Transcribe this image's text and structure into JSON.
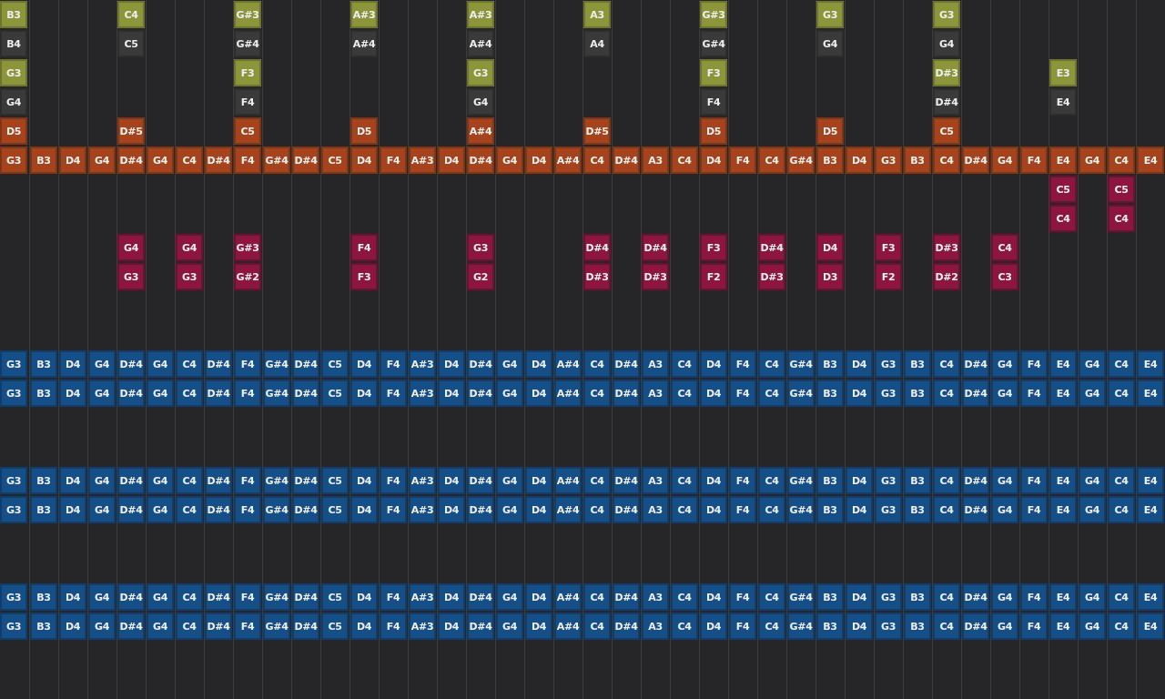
{
  "rows": [
    {
      "kind": "lane",
      "color": "#8c953a",
      "notes": [
        {
          "kind": "note",
          "label": "B3"
        },
        {
          "kind": "rest"
        },
        {
          "kind": "rest"
        },
        {
          "kind": "rest"
        },
        {
          "kind": "note",
          "label": "C4"
        },
        {
          "kind": "rest"
        },
        {
          "kind": "rest"
        },
        {
          "kind": "rest"
        },
        {
          "kind": "note",
          "label": "G#3"
        },
        {
          "kind": "rest"
        },
        {
          "kind": "rest"
        },
        {
          "kind": "rest"
        },
        {
          "kind": "note",
          "label": "A#3"
        },
        {
          "kind": "rest"
        },
        {
          "kind": "rest"
        },
        {
          "kind": "rest"
        },
        {
          "kind": "note",
          "label": "A#3"
        },
        {
          "kind": "rest"
        },
        {
          "kind": "rest"
        },
        {
          "kind": "rest"
        },
        {
          "kind": "note",
          "label": "A3"
        },
        {
          "kind": "rest"
        },
        {
          "kind": "rest"
        },
        {
          "kind": "rest"
        },
        {
          "kind": "note",
          "label": "G#3"
        },
        {
          "kind": "rest"
        },
        {
          "kind": "rest"
        },
        {
          "kind": "rest"
        },
        {
          "kind": "note",
          "label": "G3"
        },
        {
          "kind": "rest"
        },
        {
          "kind": "rest"
        },
        {
          "kind": "rest"
        },
        {
          "kind": "note",
          "label": "G3"
        },
        {
          "kind": "rest"
        },
        {
          "kind": "rest"
        },
        {
          "kind": "rest"
        },
        {
          "kind": "rest"
        },
        {
          "kind": "rest"
        },
        {
          "kind": "rest"
        },
        {
          "kind": "rest"
        }
      ]
    },
    {
      "kind": "lane",
      "color": "#3a3a3b",
      "notes": [
        {
          "kind": "note",
          "label": "B4"
        },
        {
          "kind": "rest"
        },
        {
          "kind": "rest"
        },
        {
          "kind": "rest"
        },
        {
          "kind": "note",
          "label": "C5"
        },
        {
          "kind": "rest"
        },
        {
          "kind": "rest"
        },
        {
          "kind": "rest"
        },
        {
          "kind": "note",
          "label": "G#4"
        },
        {
          "kind": "rest"
        },
        {
          "kind": "rest"
        },
        {
          "kind": "rest"
        },
        {
          "kind": "note",
          "label": "A#4"
        },
        {
          "kind": "rest"
        },
        {
          "kind": "rest"
        },
        {
          "kind": "rest"
        },
        {
          "kind": "note",
          "label": "A#4"
        },
        {
          "kind": "rest"
        },
        {
          "kind": "rest"
        },
        {
          "kind": "rest"
        },
        {
          "kind": "note",
          "label": "A4"
        },
        {
          "kind": "rest"
        },
        {
          "kind": "rest"
        },
        {
          "kind": "rest"
        },
        {
          "kind": "note",
          "label": "G#4"
        },
        {
          "kind": "rest"
        },
        {
          "kind": "rest"
        },
        {
          "kind": "rest"
        },
        {
          "kind": "note",
          "label": "G4"
        },
        {
          "kind": "rest"
        },
        {
          "kind": "rest"
        },
        {
          "kind": "rest"
        },
        {
          "kind": "note",
          "label": "G4"
        },
        {
          "kind": "rest"
        },
        {
          "kind": "rest"
        },
        {
          "kind": "rest"
        },
        {
          "kind": "rest"
        },
        {
          "kind": "rest"
        },
        {
          "kind": "rest"
        },
        {
          "kind": "rest"
        }
      ]
    },
    {
      "kind": "lane",
      "color": "#8c953a",
      "notes": [
        {
          "kind": "note",
          "label": "G3"
        },
        {
          "kind": "rest"
        },
        {
          "kind": "rest"
        },
        {
          "kind": "rest"
        },
        {
          "kind": "rest"
        },
        {
          "kind": "rest"
        },
        {
          "kind": "rest"
        },
        {
          "kind": "rest"
        },
        {
          "kind": "note",
          "label": "F3"
        },
        {
          "kind": "rest"
        },
        {
          "kind": "rest"
        },
        {
          "kind": "rest"
        },
        {
          "kind": "rest"
        },
        {
          "kind": "rest"
        },
        {
          "kind": "rest"
        },
        {
          "kind": "rest"
        },
        {
          "kind": "note",
          "label": "G3"
        },
        {
          "kind": "rest"
        },
        {
          "kind": "rest"
        },
        {
          "kind": "rest"
        },
        {
          "kind": "rest"
        },
        {
          "kind": "rest"
        },
        {
          "kind": "rest"
        },
        {
          "kind": "rest"
        },
        {
          "kind": "note",
          "label": "F3"
        },
        {
          "kind": "rest"
        },
        {
          "kind": "rest"
        },
        {
          "kind": "rest"
        },
        {
          "kind": "rest"
        },
        {
          "kind": "rest"
        },
        {
          "kind": "rest"
        },
        {
          "kind": "rest"
        },
        {
          "kind": "note",
          "label": "D#3"
        },
        {
          "kind": "rest"
        },
        {
          "kind": "rest"
        },
        {
          "kind": "rest"
        },
        {
          "kind": "note",
          "label": "E3"
        },
        {
          "kind": "rest"
        },
        {
          "kind": "rest"
        },
        {
          "kind": "rest"
        }
      ]
    },
    {
      "kind": "lane",
      "color": "#3a3a3b",
      "notes": [
        {
          "kind": "note",
          "label": "G4"
        },
        {
          "kind": "rest"
        },
        {
          "kind": "rest"
        },
        {
          "kind": "rest"
        },
        {
          "kind": "rest"
        },
        {
          "kind": "rest"
        },
        {
          "kind": "rest"
        },
        {
          "kind": "rest"
        },
        {
          "kind": "note",
          "label": "F4"
        },
        {
          "kind": "rest"
        },
        {
          "kind": "rest"
        },
        {
          "kind": "rest"
        },
        {
          "kind": "rest"
        },
        {
          "kind": "rest"
        },
        {
          "kind": "rest"
        },
        {
          "kind": "rest"
        },
        {
          "kind": "note",
          "label": "G4"
        },
        {
          "kind": "rest"
        },
        {
          "kind": "rest"
        },
        {
          "kind": "rest"
        },
        {
          "kind": "rest"
        },
        {
          "kind": "rest"
        },
        {
          "kind": "rest"
        },
        {
          "kind": "rest"
        },
        {
          "kind": "note",
          "label": "F4"
        },
        {
          "kind": "rest"
        },
        {
          "kind": "rest"
        },
        {
          "kind": "rest"
        },
        {
          "kind": "rest"
        },
        {
          "kind": "rest"
        },
        {
          "kind": "rest"
        },
        {
          "kind": "rest"
        },
        {
          "kind": "note",
          "label": "D#4"
        },
        {
          "kind": "rest"
        },
        {
          "kind": "rest"
        },
        {
          "kind": "rest"
        },
        {
          "kind": "note",
          "label": "E4"
        },
        {
          "kind": "rest"
        },
        {
          "kind": "rest"
        },
        {
          "kind": "rest"
        }
      ]
    },
    {
      "kind": "lane",
      "color": "#a5441c",
      "notes": [
        {
          "kind": "note",
          "label": "D5"
        },
        {
          "kind": "rest"
        },
        {
          "kind": "rest"
        },
        {
          "kind": "rest"
        },
        {
          "kind": "note",
          "label": "D#5"
        },
        {
          "kind": "rest"
        },
        {
          "kind": "rest"
        },
        {
          "kind": "rest"
        },
        {
          "kind": "note",
          "label": "C5"
        },
        {
          "kind": "rest"
        },
        {
          "kind": "rest"
        },
        {
          "kind": "rest"
        },
        {
          "kind": "note",
          "label": "D5"
        },
        {
          "kind": "rest"
        },
        {
          "kind": "rest"
        },
        {
          "kind": "rest"
        },
        {
          "kind": "note",
          "label": "A#4"
        },
        {
          "kind": "rest"
        },
        {
          "kind": "rest"
        },
        {
          "kind": "rest"
        },
        {
          "kind": "note",
          "label": "D#5"
        },
        {
          "kind": "rest"
        },
        {
          "kind": "rest"
        },
        {
          "kind": "rest"
        },
        {
          "kind": "note",
          "label": "D5"
        },
        {
          "kind": "rest"
        },
        {
          "kind": "rest"
        },
        {
          "kind": "rest"
        },
        {
          "kind": "note",
          "label": "D5"
        },
        {
          "kind": "rest"
        },
        {
          "kind": "rest"
        },
        {
          "kind": "rest"
        },
        {
          "kind": "note",
          "label": "C5"
        },
        {
          "kind": "rest"
        },
        {
          "kind": "rest"
        },
        {
          "kind": "rest"
        },
        {
          "kind": "rest"
        },
        {
          "kind": "rest"
        },
        {
          "kind": "rest"
        },
        {
          "kind": "rest"
        }
      ]
    },
    {
      "kind": "lane",
      "color": "#a5441c",
      "notes": [
        {
          "kind": "note",
          "label": "G3"
        },
        {
          "kind": "note",
          "label": "B3"
        },
        {
          "kind": "note",
          "label": "D4"
        },
        {
          "kind": "note",
          "label": "G4"
        },
        {
          "kind": "note",
          "label": "D#4"
        },
        {
          "kind": "note",
          "label": "G4"
        },
        {
          "kind": "note",
          "label": "C4"
        },
        {
          "kind": "note",
          "label": "D#4"
        },
        {
          "kind": "note",
          "label": "F4"
        },
        {
          "kind": "note",
          "label": "G#4"
        },
        {
          "kind": "note",
          "label": "D#4"
        },
        {
          "kind": "note",
          "label": "C5"
        },
        {
          "kind": "note",
          "label": "D4"
        },
        {
          "kind": "note",
          "label": "F4"
        },
        {
          "kind": "note",
          "label": "A#3"
        },
        {
          "kind": "note",
          "label": "D4"
        },
        {
          "kind": "note",
          "label": "D#4"
        },
        {
          "kind": "note",
          "label": "G4"
        },
        {
          "kind": "note",
          "label": "D4"
        },
        {
          "kind": "note",
          "label": "A#4"
        },
        {
          "kind": "note",
          "label": "C4"
        },
        {
          "kind": "note",
          "label": "D#4"
        },
        {
          "kind": "note",
          "label": "A3"
        },
        {
          "kind": "note",
          "label": "C4"
        },
        {
          "kind": "note",
          "label": "D4"
        },
        {
          "kind": "note",
          "label": "F4"
        },
        {
          "kind": "note",
          "label": "C4"
        },
        {
          "kind": "note",
          "label": "G#4"
        },
        {
          "kind": "note",
          "label": "B3"
        },
        {
          "kind": "note",
          "label": "D4"
        },
        {
          "kind": "note",
          "label": "G3"
        },
        {
          "kind": "note",
          "label": "B3"
        },
        {
          "kind": "note",
          "label": "C4"
        },
        {
          "kind": "note",
          "label": "D#4"
        },
        {
          "kind": "note",
          "label": "G4"
        },
        {
          "kind": "note",
          "label": "F4"
        },
        {
          "kind": "note",
          "label": "E4"
        },
        {
          "kind": "note",
          "label": "G4"
        },
        {
          "kind": "note",
          "label": "C4"
        },
        {
          "kind": "note",
          "label": "E4"
        }
      ]
    },
    {
      "kind": "lane",
      "color": "#8c1640",
      "notes": [
        {
          "kind": "rest"
        },
        {
          "kind": "rest"
        },
        {
          "kind": "rest"
        },
        {
          "kind": "rest"
        },
        {
          "kind": "rest"
        },
        {
          "kind": "rest"
        },
        {
          "kind": "rest"
        },
        {
          "kind": "rest"
        },
        {
          "kind": "rest"
        },
        {
          "kind": "rest"
        },
        {
          "kind": "rest"
        },
        {
          "kind": "rest"
        },
        {
          "kind": "rest"
        },
        {
          "kind": "rest"
        },
        {
          "kind": "rest"
        },
        {
          "kind": "rest"
        },
        {
          "kind": "rest"
        },
        {
          "kind": "rest"
        },
        {
          "kind": "rest"
        },
        {
          "kind": "rest"
        },
        {
          "kind": "rest"
        },
        {
          "kind": "rest"
        },
        {
          "kind": "rest"
        },
        {
          "kind": "rest"
        },
        {
          "kind": "rest"
        },
        {
          "kind": "rest"
        },
        {
          "kind": "rest"
        },
        {
          "kind": "rest"
        },
        {
          "kind": "rest"
        },
        {
          "kind": "rest"
        },
        {
          "kind": "rest"
        },
        {
          "kind": "rest"
        },
        {
          "kind": "rest"
        },
        {
          "kind": "rest"
        },
        {
          "kind": "rest"
        },
        {
          "kind": "rest"
        },
        {
          "kind": "note",
          "label": "C5"
        },
        {
          "kind": "rest"
        },
        {
          "kind": "note",
          "label": "C5"
        },
        {
          "kind": "rest"
        }
      ]
    },
    {
      "kind": "lane",
      "color": "#8c1640",
      "notes": [
        {
          "kind": "rest"
        },
        {
          "kind": "rest"
        },
        {
          "kind": "rest"
        },
        {
          "kind": "rest"
        },
        {
          "kind": "rest"
        },
        {
          "kind": "rest"
        },
        {
          "kind": "rest"
        },
        {
          "kind": "rest"
        },
        {
          "kind": "rest"
        },
        {
          "kind": "rest"
        },
        {
          "kind": "rest"
        },
        {
          "kind": "rest"
        },
        {
          "kind": "rest"
        },
        {
          "kind": "rest"
        },
        {
          "kind": "rest"
        },
        {
          "kind": "rest"
        },
        {
          "kind": "rest"
        },
        {
          "kind": "rest"
        },
        {
          "kind": "rest"
        },
        {
          "kind": "rest"
        },
        {
          "kind": "rest"
        },
        {
          "kind": "rest"
        },
        {
          "kind": "rest"
        },
        {
          "kind": "rest"
        },
        {
          "kind": "rest"
        },
        {
          "kind": "rest"
        },
        {
          "kind": "rest"
        },
        {
          "kind": "rest"
        },
        {
          "kind": "rest"
        },
        {
          "kind": "rest"
        },
        {
          "kind": "rest"
        },
        {
          "kind": "rest"
        },
        {
          "kind": "rest"
        },
        {
          "kind": "rest"
        },
        {
          "kind": "rest"
        },
        {
          "kind": "rest"
        },
        {
          "kind": "note",
          "label": "C4"
        },
        {
          "kind": "rest"
        },
        {
          "kind": "note",
          "label": "C4"
        },
        {
          "kind": "rest"
        }
      ]
    },
    {
      "kind": "lane",
      "color": "#8c1640",
      "notes": [
        {
          "kind": "rest"
        },
        {
          "kind": "rest"
        },
        {
          "kind": "rest"
        },
        {
          "kind": "rest"
        },
        {
          "kind": "note",
          "label": "G4"
        },
        {
          "kind": "rest"
        },
        {
          "kind": "note",
          "label": "G4"
        },
        {
          "kind": "rest"
        },
        {
          "kind": "note",
          "label": "G#3"
        },
        {
          "kind": "rest"
        },
        {
          "kind": "rest"
        },
        {
          "kind": "rest"
        },
        {
          "kind": "note",
          "label": "F4"
        },
        {
          "kind": "rest"
        },
        {
          "kind": "rest"
        },
        {
          "kind": "rest"
        },
        {
          "kind": "note",
          "label": "G3"
        },
        {
          "kind": "rest"
        },
        {
          "kind": "rest"
        },
        {
          "kind": "rest"
        },
        {
          "kind": "note",
          "label": "D#4"
        },
        {
          "kind": "rest"
        },
        {
          "kind": "note",
          "label": "D#4"
        },
        {
          "kind": "rest"
        },
        {
          "kind": "note",
          "label": "F3"
        },
        {
          "kind": "rest"
        },
        {
          "kind": "note",
          "label": "D#4"
        },
        {
          "kind": "rest"
        },
        {
          "kind": "note",
          "label": "D4"
        },
        {
          "kind": "rest"
        },
        {
          "kind": "note",
          "label": "F3"
        },
        {
          "kind": "rest"
        },
        {
          "kind": "note",
          "label": "D#3"
        },
        {
          "kind": "rest"
        },
        {
          "kind": "note",
          "label": "C4"
        },
        {
          "kind": "rest"
        },
        {
          "kind": "rest"
        },
        {
          "kind": "rest"
        },
        {
          "kind": "rest"
        },
        {
          "kind": "rest"
        }
      ]
    },
    {
      "kind": "lane",
      "color": "#8c1640",
      "notes": [
        {
          "kind": "rest"
        },
        {
          "kind": "rest"
        },
        {
          "kind": "rest"
        },
        {
          "kind": "rest"
        },
        {
          "kind": "note",
          "label": "G3"
        },
        {
          "kind": "rest"
        },
        {
          "kind": "note",
          "label": "G3"
        },
        {
          "kind": "rest"
        },
        {
          "kind": "note",
          "label": "G#2"
        },
        {
          "kind": "rest"
        },
        {
          "kind": "rest"
        },
        {
          "kind": "rest"
        },
        {
          "kind": "note",
          "label": "F3"
        },
        {
          "kind": "rest"
        },
        {
          "kind": "rest"
        },
        {
          "kind": "rest"
        },
        {
          "kind": "note",
          "label": "G2"
        },
        {
          "kind": "rest"
        },
        {
          "kind": "rest"
        },
        {
          "kind": "rest"
        },
        {
          "kind": "note",
          "label": "D#3"
        },
        {
          "kind": "rest"
        },
        {
          "kind": "note",
          "label": "D#3"
        },
        {
          "kind": "rest"
        },
        {
          "kind": "note",
          "label": "F2"
        },
        {
          "kind": "rest"
        },
        {
          "kind": "note",
          "label": "D#3"
        },
        {
          "kind": "rest"
        },
        {
          "kind": "note",
          "label": "D3"
        },
        {
          "kind": "rest"
        },
        {
          "kind": "note",
          "label": "F2"
        },
        {
          "kind": "rest"
        },
        {
          "kind": "note",
          "label": "D#2"
        },
        {
          "kind": "rest"
        },
        {
          "kind": "note",
          "label": "C3"
        },
        {
          "kind": "rest"
        },
        {
          "kind": "rest"
        },
        {
          "kind": "rest"
        },
        {
          "kind": "rest"
        },
        {
          "kind": "rest"
        }
      ]
    },
    {
      "kind": "spacer"
    },
    {
      "kind": "spacer"
    },
    {
      "kind": "lane",
      "color": "#154f88",
      "notes": [
        {
          "kind": "note",
          "label": "G3"
        },
        {
          "kind": "note",
          "label": "B3"
        },
        {
          "kind": "note",
          "label": "D4"
        },
        {
          "kind": "note",
          "label": "G4"
        },
        {
          "kind": "note",
          "label": "D#4"
        },
        {
          "kind": "note",
          "label": "G4"
        },
        {
          "kind": "note",
          "label": "C4"
        },
        {
          "kind": "note",
          "label": "D#4"
        },
        {
          "kind": "note",
          "label": "F4"
        },
        {
          "kind": "note",
          "label": "G#4"
        },
        {
          "kind": "note",
          "label": "D#4"
        },
        {
          "kind": "note",
          "label": "C5"
        },
        {
          "kind": "note",
          "label": "D4"
        },
        {
          "kind": "note",
          "label": "F4"
        },
        {
          "kind": "note",
          "label": "A#3"
        },
        {
          "kind": "note",
          "label": "D4"
        },
        {
          "kind": "note",
          "label": "D#4"
        },
        {
          "kind": "note",
          "label": "G4"
        },
        {
          "kind": "note",
          "label": "D4"
        },
        {
          "kind": "note",
          "label": "A#4"
        },
        {
          "kind": "note",
          "label": "C4"
        },
        {
          "kind": "note",
          "label": "D#4"
        },
        {
          "kind": "note",
          "label": "A3"
        },
        {
          "kind": "note",
          "label": "C4"
        },
        {
          "kind": "note",
          "label": "D4"
        },
        {
          "kind": "note",
          "label": "F4"
        },
        {
          "kind": "note",
          "label": "C4"
        },
        {
          "kind": "note",
          "label": "G#4"
        },
        {
          "kind": "note",
          "label": "B3"
        },
        {
          "kind": "note",
          "label": "D4"
        },
        {
          "kind": "note",
          "label": "G3"
        },
        {
          "kind": "note",
          "label": "B3"
        },
        {
          "kind": "note",
          "label": "C4"
        },
        {
          "kind": "note",
          "label": "D#4"
        },
        {
          "kind": "note",
          "label": "G4"
        },
        {
          "kind": "note",
          "label": "F4"
        },
        {
          "kind": "note",
          "label": "E4"
        },
        {
          "kind": "note",
          "label": "G4"
        },
        {
          "kind": "note",
          "label": "C4"
        },
        {
          "kind": "note",
          "label": "E4"
        }
      ]
    },
    {
      "kind": "lane",
      "color": "#154f88",
      "notes": [
        {
          "kind": "note",
          "label": "G3"
        },
        {
          "kind": "note",
          "label": "B3"
        },
        {
          "kind": "note",
          "label": "D4"
        },
        {
          "kind": "note",
          "label": "G4"
        },
        {
          "kind": "note",
          "label": "D#4"
        },
        {
          "kind": "note",
          "label": "G4"
        },
        {
          "kind": "note",
          "label": "C4"
        },
        {
          "kind": "note",
          "label": "D#4"
        },
        {
          "kind": "note",
          "label": "F4"
        },
        {
          "kind": "note",
          "label": "G#4"
        },
        {
          "kind": "note",
          "label": "D#4"
        },
        {
          "kind": "note",
          "label": "C5"
        },
        {
          "kind": "note",
          "label": "D4"
        },
        {
          "kind": "note",
          "label": "F4"
        },
        {
          "kind": "note",
          "label": "A#3"
        },
        {
          "kind": "note",
          "label": "D4"
        },
        {
          "kind": "note",
          "label": "D#4"
        },
        {
          "kind": "note",
          "label": "G4"
        },
        {
          "kind": "note",
          "label": "D4"
        },
        {
          "kind": "note",
          "label": "A#4"
        },
        {
          "kind": "note",
          "label": "C4"
        },
        {
          "kind": "note",
          "label": "D#4"
        },
        {
          "kind": "note",
          "label": "A3"
        },
        {
          "kind": "note",
          "label": "C4"
        },
        {
          "kind": "note",
          "label": "D4"
        },
        {
          "kind": "note",
          "label": "F4"
        },
        {
          "kind": "note",
          "label": "C4"
        },
        {
          "kind": "note",
          "label": "G#4"
        },
        {
          "kind": "note",
          "label": "B3"
        },
        {
          "kind": "note",
          "label": "D4"
        },
        {
          "kind": "note",
          "label": "G3"
        },
        {
          "kind": "note",
          "label": "B3"
        },
        {
          "kind": "note",
          "label": "C4"
        },
        {
          "kind": "note",
          "label": "D#4"
        },
        {
          "kind": "note",
          "label": "G4"
        },
        {
          "kind": "note",
          "label": "F4"
        },
        {
          "kind": "note",
          "label": "E4"
        },
        {
          "kind": "note",
          "label": "G4"
        },
        {
          "kind": "note",
          "label": "C4"
        },
        {
          "kind": "note",
          "label": "E4"
        }
      ]
    },
    {
      "kind": "spacer"
    },
    {
      "kind": "spacer"
    },
    {
      "kind": "lane",
      "color": "#154f88",
      "notes": [
        {
          "kind": "note",
          "label": "G3"
        },
        {
          "kind": "note",
          "label": "B3"
        },
        {
          "kind": "note",
          "label": "D4"
        },
        {
          "kind": "note",
          "label": "G4"
        },
        {
          "kind": "note",
          "label": "D#4"
        },
        {
          "kind": "note",
          "label": "G4"
        },
        {
          "kind": "note",
          "label": "C4"
        },
        {
          "kind": "note",
          "label": "D#4"
        },
        {
          "kind": "note",
          "label": "F4"
        },
        {
          "kind": "note",
          "label": "G#4"
        },
        {
          "kind": "note",
          "label": "D#4"
        },
        {
          "kind": "note",
          "label": "C5"
        },
        {
          "kind": "note",
          "label": "D4"
        },
        {
          "kind": "note",
          "label": "F4"
        },
        {
          "kind": "note",
          "label": "A#3"
        },
        {
          "kind": "note",
          "label": "D4"
        },
        {
          "kind": "note",
          "label": "D#4"
        },
        {
          "kind": "note",
          "label": "G4"
        },
        {
          "kind": "note",
          "label": "D4"
        },
        {
          "kind": "note",
          "label": "A#4"
        },
        {
          "kind": "note",
          "label": "C4"
        },
        {
          "kind": "note",
          "label": "D#4"
        },
        {
          "kind": "note",
          "label": "A3"
        },
        {
          "kind": "note",
          "label": "C4"
        },
        {
          "kind": "note",
          "label": "D4"
        },
        {
          "kind": "note",
          "label": "F4"
        },
        {
          "kind": "note",
          "label": "C4"
        },
        {
          "kind": "note",
          "label": "G#4"
        },
        {
          "kind": "note",
          "label": "B3"
        },
        {
          "kind": "note",
          "label": "D4"
        },
        {
          "kind": "note",
          "label": "G3"
        },
        {
          "kind": "note",
          "label": "B3"
        },
        {
          "kind": "note",
          "label": "C4"
        },
        {
          "kind": "note",
          "label": "D#4"
        },
        {
          "kind": "note",
          "label": "G4"
        },
        {
          "kind": "note",
          "label": "F4"
        },
        {
          "kind": "note",
          "label": "E4"
        },
        {
          "kind": "note",
          "label": "G4"
        },
        {
          "kind": "note",
          "label": "C4"
        },
        {
          "kind": "note",
          "label": "E4"
        }
      ]
    },
    {
      "kind": "lane",
      "color": "#154f88",
      "notes": [
        {
          "kind": "note",
          "label": "G3"
        },
        {
          "kind": "note",
          "label": "B3"
        },
        {
          "kind": "note",
          "label": "D4"
        },
        {
          "kind": "note",
          "label": "G4"
        },
        {
          "kind": "note",
          "label": "D#4"
        },
        {
          "kind": "note",
          "label": "G4"
        },
        {
          "kind": "note",
          "label": "C4"
        },
        {
          "kind": "note",
          "label": "D#4"
        },
        {
          "kind": "note",
          "label": "F4"
        },
        {
          "kind": "note",
          "label": "G#4"
        },
        {
          "kind": "note",
          "label": "D#4"
        },
        {
          "kind": "note",
          "label": "C5"
        },
        {
          "kind": "note",
          "label": "D4"
        },
        {
          "kind": "note",
          "label": "F4"
        },
        {
          "kind": "note",
          "label": "A#3"
        },
        {
          "kind": "note",
          "label": "D4"
        },
        {
          "kind": "note",
          "label": "D#4"
        },
        {
          "kind": "note",
          "label": "G4"
        },
        {
          "kind": "note",
          "label": "D4"
        },
        {
          "kind": "note",
          "label": "A#4"
        },
        {
          "kind": "note",
          "label": "C4"
        },
        {
          "kind": "note",
          "label": "D#4"
        },
        {
          "kind": "note",
          "label": "A3"
        },
        {
          "kind": "note",
          "label": "C4"
        },
        {
          "kind": "note",
          "label": "D4"
        },
        {
          "kind": "note",
          "label": "F4"
        },
        {
          "kind": "note",
          "label": "C4"
        },
        {
          "kind": "note",
          "label": "G#4"
        },
        {
          "kind": "note",
          "label": "B3"
        },
        {
          "kind": "note",
          "label": "D4"
        },
        {
          "kind": "note",
          "label": "G3"
        },
        {
          "kind": "note",
          "label": "B3"
        },
        {
          "kind": "note",
          "label": "C4"
        },
        {
          "kind": "note",
          "label": "D#4"
        },
        {
          "kind": "note",
          "label": "G4"
        },
        {
          "kind": "note",
          "label": "F4"
        },
        {
          "kind": "note",
          "label": "E4"
        },
        {
          "kind": "note",
          "label": "G4"
        },
        {
          "kind": "note",
          "label": "C4"
        },
        {
          "kind": "note",
          "label": "E4"
        }
      ]
    },
    {
      "kind": "spacer"
    },
    {
      "kind": "spacer"
    },
    {
      "kind": "lane",
      "color": "#154f88",
      "notes": [
        {
          "kind": "note",
          "label": "G3"
        },
        {
          "kind": "note",
          "label": "B3"
        },
        {
          "kind": "note",
          "label": "D4"
        },
        {
          "kind": "note",
          "label": "G4"
        },
        {
          "kind": "note",
          "label": "D#4"
        },
        {
          "kind": "note",
          "label": "G4"
        },
        {
          "kind": "note",
          "label": "C4"
        },
        {
          "kind": "note",
          "label": "D#4"
        },
        {
          "kind": "note",
          "label": "F4"
        },
        {
          "kind": "note",
          "label": "G#4"
        },
        {
          "kind": "note",
          "label": "D#4"
        },
        {
          "kind": "note",
          "label": "C5"
        },
        {
          "kind": "note",
          "label": "D4"
        },
        {
          "kind": "note",
          "label": "F4"
        },
        {
          "kind": "note",
          "label": "A#3"
        },
        {
          "kind": "note",
          "label": "D4"
        },
        {
          "kind": "note",
          "label": "D#4"
        },
        {
          "kind": "note",
          "label": "G4"
        },
        {
          "kind": "note",
          "label": "D4"
        },
        {
          "kind": "note",
          "label": "A#4"
        },
        {
          "kind": "note",
          "label": "C4"
        },
        {
          "kind": "note",
          "label": "D#4"
        },
        {
          "kind": "note",
          "label": "A3"
        },
        {
          "kind": "note",
          "label": "C4"
        },
        {
          "kind": "note",
          "label": "D4"
        },
        {
          "kind": "note",
          "label": "F4"
        },
        {
          "kind": "note",
          "label": "C4"
        },
        {
          "kind": "note",
          "label": "G#4"
        },
        {
          "kind": "note",
          "label": "B3"
        },
        {
          "kind": "note",
          "label": "D4"
        },
        {
          "kind": "note",
          "label": "G3"
        },
        {
          "kind": "note",
          "label": "B3"
        },
        {
          "kind": "note",
          "label": "C4"
        },
        {
          "kind": "note",
          "label": "D#4"
        },
        {
          "kind": "note",
          "label": "G4"
        },
        {
          "kind": "note",
          "label": "F4"
        },
        {
          "kind": "note",
          "label": "E4"
        },
        {
          "kind": "note",
          "label": "G4"
        },
        {
          "kind": "note",
          "label": "C4"
        },
        {
          "kind": "note",
          "label": "E4"
        }
      ]
    },
    {
      "kind": "lane",
      "color": "#154f88",
      "notes": [
        {
          "kind": "note",
          "label": "G3"
        },
        {
          "kind": "note",
          "label": "B3"
        },
        {
          "kind": "note",
          "label": "D4"
        },
        {
          "kind": "note",
          "label": "G4"
        },
        {
          "kind": "note",
          "label": "D#4"
        },
        {
          "kind": "note",
          "label": "G4"
        },
        {
          "kind": "note",
          "label": "C4"
        },
        {
          "kind": "note",
          "label": "D#4"
        },
        {
          "kind": "note",
          "label": "F4"
        },
        {
          "kind": "note",
          "label": "G#4"
        },
        {
          "kind": "note",
          "label": "D#4"
        },
        {
          "kind": "note",
          "label": "C5"
        },
        {
          "kind": "note",
          "label": "D4"
        },
        {
          "kind": "note",
          "label": "F4"
        },
        {
          "kind": "note",
          "label": "A#3"
        },
        {
          "kind": "note",
          "label": "D4"
        },
        {
          "kind": "note",
          "label": "D#4"
        },
        {
          "kind": "note",
          "label": "G4"
        },
        {
          "kind": "note",
          "label": "D4"
        },
        {
          "kind": "note",
          "label": "A#4"
        },
        {
          "kind": "note",
          "label": "C4"
        },
        {
          "kind": "note",
          "label": "D#4"
        },
        {
          "kind": "note",
          "label": "A3"
        },
        {
          "kind": "note",
          "label": "C4"
        },
        {
          "kind": "note",
          "label": "D4"
        },
        {
          "kind": "note",
          "label": "F4"
        },
        {
          "kind": "note",
          "label": "C4"
        },
        {
          "kind": "note",
          "label": "G#4"
        },
        {
          "kind": "note",
          "label": "B3"
        },
        {
          "kind": "note",
          "label": "D4"
        },
        {
          "kind": "note",
          "label": "G3"
        },
        {
          "kind": "note",
          "label": "B3"
        },
        {
          "kind": "note",
          "label": "C4"
        },
        {
          "kind": "note",
          "label": "D#4"
        },
        {
          "kind": "note",
          "label": "G4"
        },
        {
          "kind": "note",
          "label": "F4"
        },
        {
          "kind": "note",
          "label": "E4"
        },
        {
          "kind": "note",
          "label": "G4"
        },
        {
          "kind": "note",
          "label": "C4"
        },
        {
          "kind": "note",
          "label": "E4"
        }
      ]
    },
    {
      "kind": "spacer"
    },
    {
      "kind": "spacer"
    }
  ]
}
